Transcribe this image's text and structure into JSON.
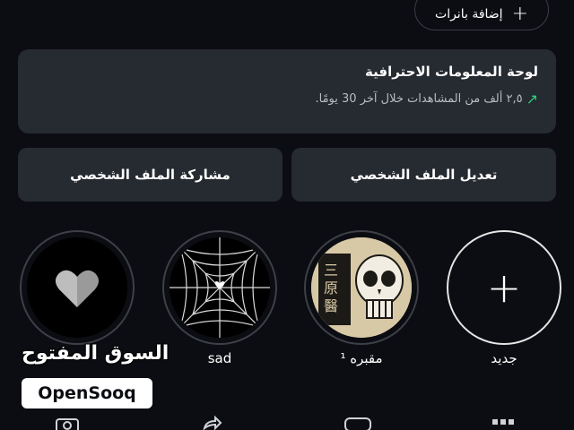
{
  "header": {
    "add_banners_label": "إضافة بانرات"
  },
  "dashboard": {
    "title": "لوحة المعلومات الاحترافية",
    "stats": "٢,٥ ألف من المشاهدات خلال آخر 30 يومًا."
  },
  "actions": {
    "edit_profile": "تعديل الملف الشخصي",
    "share_profile": "مشاركة الملف الشخصي"
  },
  "highlights": [
    {
      "label": "جديد",
      "icon": "plus-icon"
    },
    {
      "label": "مقبره ¹",
      "icon": "skull-image"
    },
    {
      "label": "sad",
      "icon": "spiderweb-image"
    },
    {
      "label": "",
      "icon": "heart-image"
    }
  ],
  "watermark": {
    "arabic": "السوق المفتوح",
    "english": "OpenSooq"
  },
  "colors": {
    "background": "#0b0d12",
    "card": "#262a31",
    "accent_up": "#2fd07a"
  }
}
